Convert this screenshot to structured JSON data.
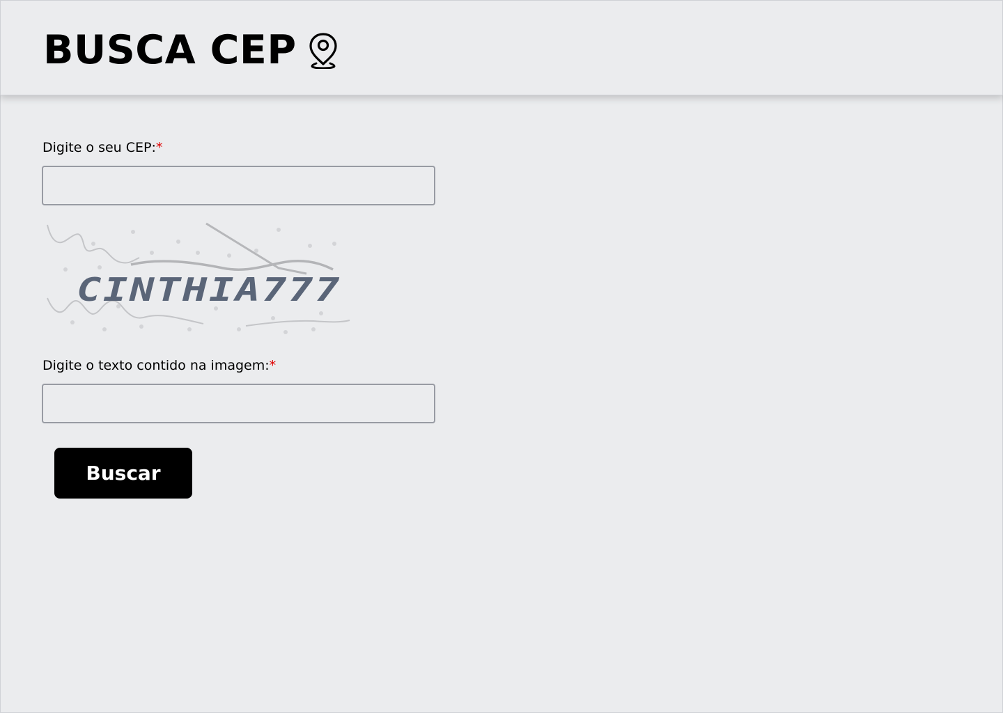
{
  "header": {
    "title": "BUSCA CEP",
    "icon": "map-pin-icon"
  },
  "form": {
    "cep_label": "Digite o seu CEP:",
    "captcha_label": "Digite o texto contido na imagem:",
    "required_mark": "*",
    "cep_value": "",
    "captcha_value": "",
    "captcha_text": "CINTHIA777",
    "submit_label": "Buscar"
  },
  "colors": {
    "background": "#ebecee",
    "required": "#e00000",
    "button": "#000000",
    "captcha_text": "#5a6578"
  }
}
